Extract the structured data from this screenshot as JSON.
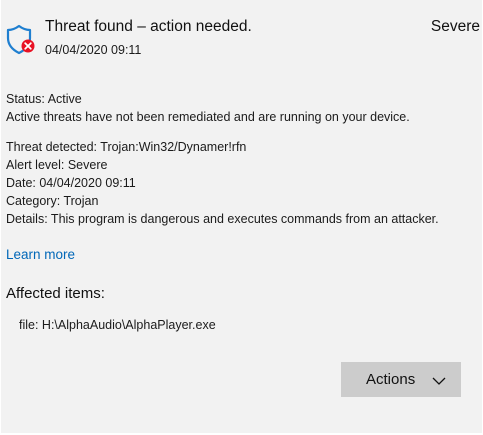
{
  "threat": {
    "title": "Threat found – action needed.",
    "timestamp": "04/04/2020 09:11",
    "severity": "Severe",
    "status_line": "Status:  Active",
    "status_description": "Active threats have not been remediated and are running on your device.",
    "details": [
      "Threat detected:  Trojan:Win32/Dynamer!rfn",
      "Alert level:  Severe",
      "Date:  04/04/2020 09:11",
      "Category:  Trojan",
      "Details:  This program is dangerous and executes commands from an attacker."
    ],
    "learn_more": "Learn more",
    "affected_heading": "Affected items:",
    "affected_item": "file: H:\\AlphaAudio\\AlphaPlayer.exe"
  },
  "actions": {
    "label": "Actions"
  },
  "icons": {
    "shield": "shield-warning-icon",
    "chevron": "chevron-down-icon"
  },
  "colors": {
    "link": "#0067b8",
    "shield_blue": "#1f7fd0",
    "alert_red": "#e81123",
    "panel_bg": "#f2f2f2",
    "button_bg": "#cccccc"
  }
}
